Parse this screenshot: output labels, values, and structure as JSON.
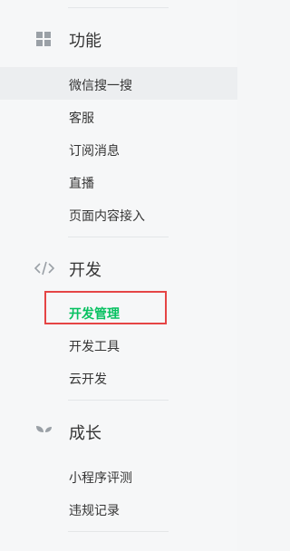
{
  "sections": [
    {
      "title": "功能",
      "icon": "grid-icon",
      "items": [
        {
          "label": "微信搜一搜",
          "state": "hover"
        },
        {
          "label": "客服"
        },
        {
          "label": "订阅消息"
        },
        {
          "label": "直播"
        },
        {
          "label": "页面内容接入"
        }
      ]
    },
    {
      "title": "开发",
      "icon": "code-icon",
      "items": [
        {
          "label": "开发管理",
          "state": "active"
        },
        {
          "label": "开发工具"
        },
        {
          "label": "云开发"
        }
      ]
    },
    {
      "title": "成长",
      "icon": "sprout-icon",
      "items": [
        {
          "label": "小程序评测"
        },
        {
          "label": "违规记录"
        }
      ]
    }
  ],
  "colors": {
    "active": "#07c160",
    "highlight_border": "#e54545",
    "hover_bg": "#eceef0",
    "icon": "#9aa0a6"
  }
}
